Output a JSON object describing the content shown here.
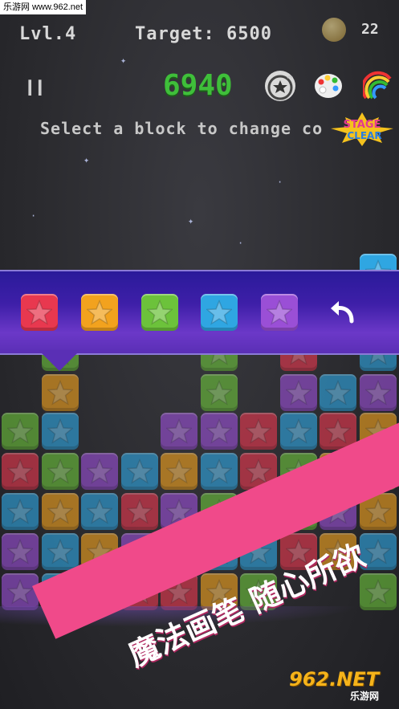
{
  "watermark": "乐游网 www.962.net",
  "hud": {
    "level": "Lvl.4",
    "target": "Target: 6500",
    "coins": "22",
    "score": "6940",
    "message": "Select a block to change co"
  },
  "stage_clear": {
    "line1": "STAGE",
    "line2": "CLEAR"
  },
  "colors": {
    "red": "#e8384f",
    "orange": "#f2a21e",
    "green": "#6cc23b",
    "blue": "#2fa6e2",
    "purple": "#9a4fd6",
    "teal": "#4aa8c8",
    "gold": "#e0a640"
  },
  "palette": {
    "options": [
      "red",
      "orange",
      "green",
      "blue",
      "purple"
    ],
    "undo_icon": "undo-arrow-icon"
  },
  "board": {
    "rows": [
      [
        "",
        "",
        "",
        "",
        "",
        "",
        "",
        "",
        "",
        "blue"
      ],
      [
        "",
        "green",
        "",
        "",
        "",
        "green",
        "",
        "red",
        "",
        "blue"
      ],
      [
        "",
        "orange",
        "",
        "",
        "",
        "green",
        "",
        "purple",
        "blue",
        "purple"
      ],
      [
        "green",
        "blue",
        "",
        "",
        "purple",
        "purple",
        "red",
        "blue",
        "red",
        "orange"
      ],
      [
        "red",
        "green",
        "purple",
        "blue",
        "orange",
        "blue",
        "red",
        "green",
        "orange",
        "green"
      ],
      [
        "blue",
        "orange",
        "blue",
        "red",
        "purple",
        "green",
        "orange",
        "green",
        "purple",
        "orange"
      ],
      [
        "purple",
        "blue",
        "orange",
        "purple",
        "orange",
        "blue",
        "blue",
        "red",
        "orange",
        "blue"
      ],
      [
        "purple",
        "blue",
        "red",
        "red",
        "red",
        "orange",
        "green",
        "",
        "",
        "green"
      ]
    ]
  },
  "banner": {
    "text": "魔法画笔 随心所欲"
  },
  "logo": {
    "brand": "962.NET",
    "sub": "乐游网"
  }
}
